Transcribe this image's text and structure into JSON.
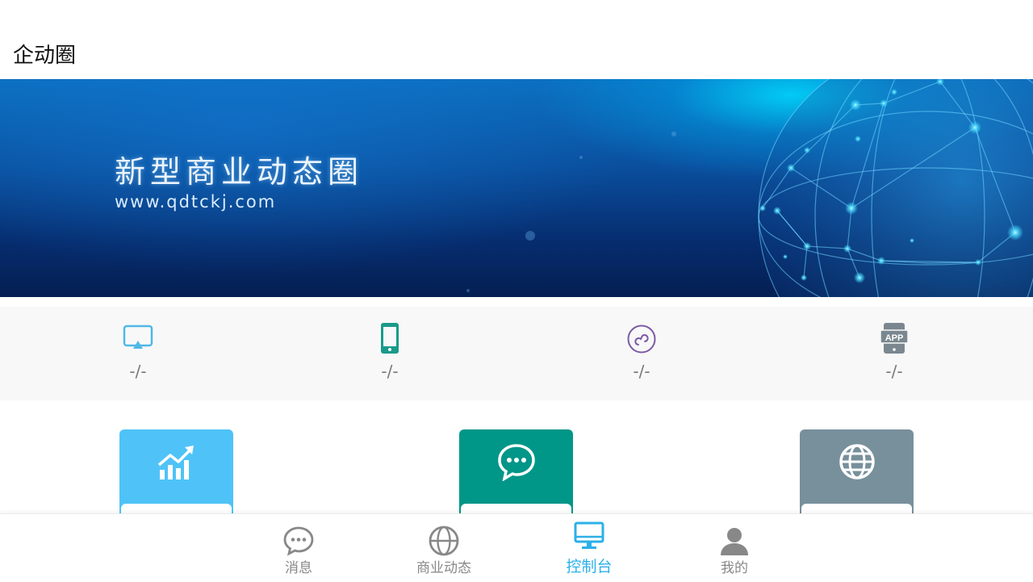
{
  "header": {
    "title": "企动圈"
  },
  "banner": {
    "title": "新型商业动态圈",
    "url": "www.qdtckj.com"
  },
  "stats": [
    {
      "icon": "monitor-icon",
      "value": "-/-",
      "color": "#4fb8e6"
    },
    {
      "icon": "mobile-phone-icon",
      "value": "-/-",
      "color": "#1a9a8a"
    },
    {
      "icon": "mini-program-link-icon",
      "value": "-/-",
      "color": "#7b5aa6"
    },
    {
      "icon": "app-icon",
      "value": "-/-",
      "color": "#7b8790"
    }
  ],
  "tiles": [
    {
      "icon": "trending-chart-icon",
      "color": "#4fc3f7"
    },
    {
      "icon": "chat-bubble-icon",
      "color": "#009688"
    },
    {
      "icon": "globe-icon",
      "color": "#78909c"
    }
  ],
  "tabbar": {
    "active_color": "#2bb0e8",
    "items": [
      {
        "label": "消息",
        "icon": "message-icon"
      },
      {
        "label": "商业动态",
        "icon": "globe-icon"
      },
      {
        "label": "控制台",
        "icon": "desktop-icon",
        "active": true
      },
      {
        "label": "我的",
        "icon": "user-icon"
      }
    ]
  }
}
